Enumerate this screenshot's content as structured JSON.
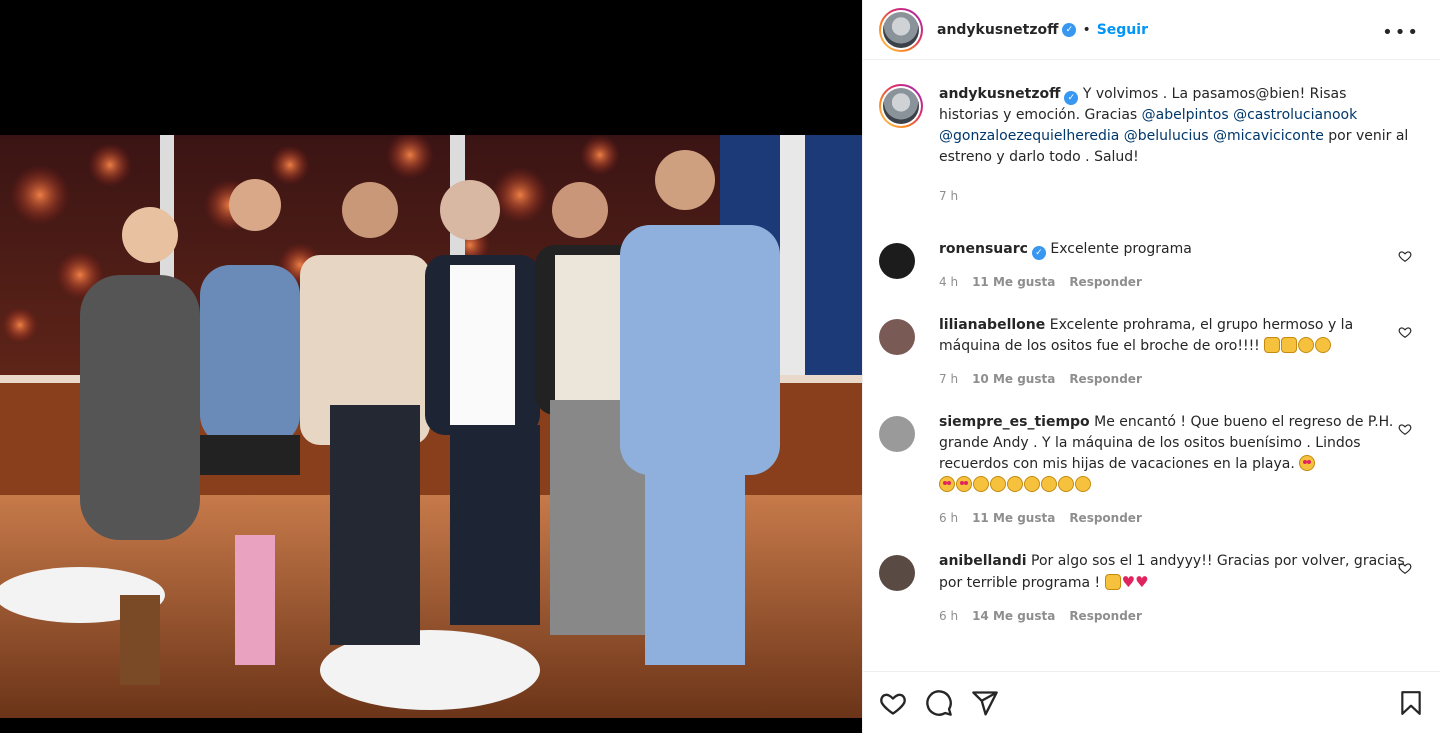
{
  "post": {
    "username": "andykusnetzoff",
    "verified_mark": "✓",
    "dot": "•",
    "follow_label": "Seguir",
    "more_label": "•••"
  },
  "caption": {
    "username": "andykusnetzoff",
    "text_1": "Y volvimos . La pasamos@bien! Risas historias y emoción. Gracias ",
    "mention_1": "@abelpintos",
    "mention_2": "@castrolucianook",
    "mention_3": "@gonzaloezequielheredia",
    "mention_4": "@belulucius",
    "mention_5": "@micaviciconte",
    "text_2": " por venir al estreno y darlo todo . Salud!",
    "time": "7 h"
  },
  "comments": [
    {
      "username": "ronensuarc",
      "verified": true,
      "text": "Excelente programa",
      "time": "4 h",
      "likes": "11 Me gusta",
      "reply": "Responder",
      "avatar_color": "#1c1c1c"
    },
    {
      "username": "lilianabellone",
      "text": "Excelente prohrama, el grupo hermoso y la máquina de los ositos fue el broche de oro!!!! ",
      "time": "7 h",
      "likes": "10 Me gusta",
      "reply": "Responder",
      "avatar_color": "#7a5a55"
    },
    {
      "username": "siempre_es_tiempo",
      "text": "Me encantó ! Que bueno el regreso de P.H. grande Andy . Y la máquina de los ositos buenísimo . Lindos recuerdos con mis hijas de vacaciones en la playa. ",
      "time": "6 h",
      "likes": "11 Me gusta",
      "reply": "Responder",
      "avatar_color": "#9a9a9a"
    },
    {
      "username": "anibellandi",
      "text": "Por algo sos el 1 andyyy!! Gracias por volver, gracias por terrible programa ! ",
      "time": "6 h",
      "likes": "14 Me gusta",
      "reply": "Responder",
      "avatar_color": "#5a4a44"
    }
  ],
  "colors": {
    "accent": "#0095f6",
    "verified": "#3897f0",
    "mention": "#00376b",
    "muted": "#8e8e8e"
  },
  "icons": [
    "like-icon",
    "comment-icon",
    "share-icon",
    "save-icon",
    "more-options-icon"
  ]
}
